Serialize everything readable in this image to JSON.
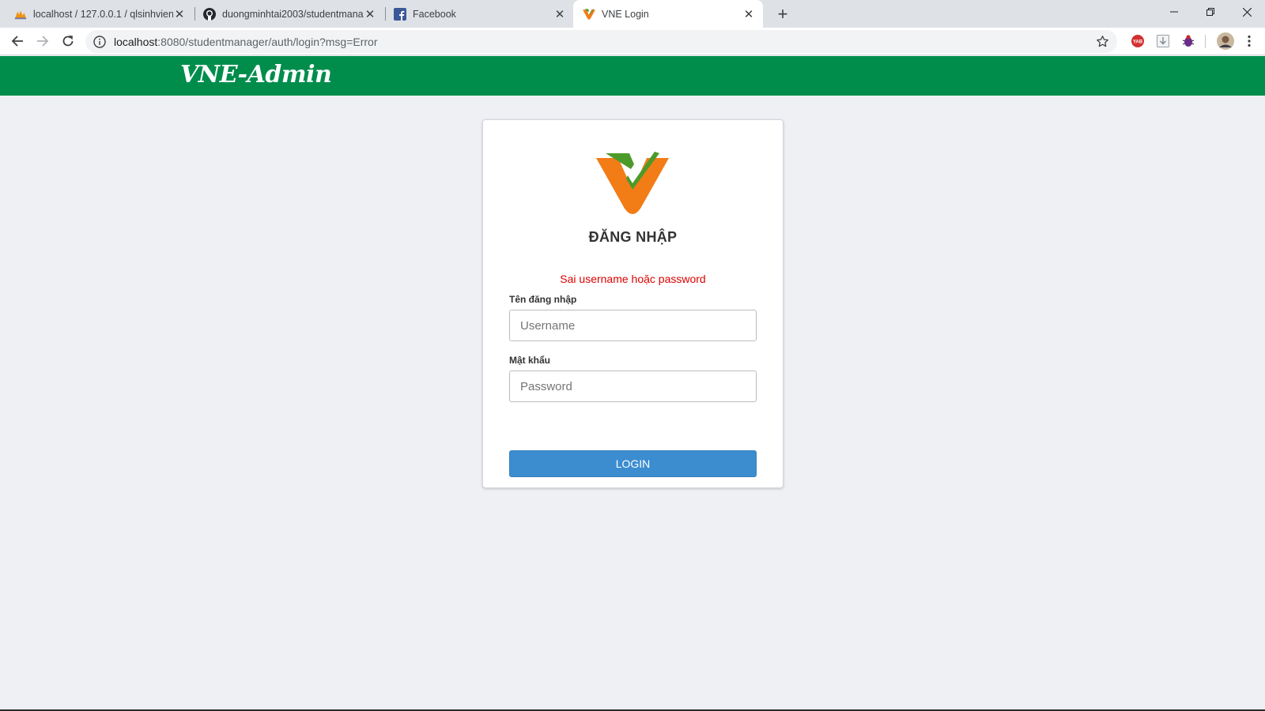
{
  "browser": {
    "tabs": [
      {
        "title": "localhost / 127.0.0.1 / qlsinhvien",
        "icon": "phpmyadmin-icon"
      },
      {
        "title": "duongminhtai2003/studentmana",
        "icon": "github-icon"
      },
      {
        "title": "Facebook",
        "icon": "facebook-icon"
      },
      {
        "title": "VNE Login",
        "icon": "vne-icon",
        "active": true
      }
    ],
    "close_glyph": "✕",
    "newtab_glyph": "+",
    "url_host": "localhost",
    "url_path": ":8080/studentmanager/auth/login?msg=Error",
    "extensions": [
      "yab-extension-icon",
      "download-extension-icon",
      "bug-extension-icon",
      "profile-avatar"
    ],
    "window_controls": {
      "minimize": "—",
      "restore": "❐",
      "close": "✕"
    }
  },
  "header": {
    "brand": "VNE-Admin",
    "color": "#008d4c"
  },
  "login": {
    "title": "ĐĂNG NHẬP",
    "error": "Sai username hoặc password",
    "username_label": "Tên đăng nhập",
    "username_placeholder": "Username",
    "username_value": "",
    "password_label": "Mật khẩu",
    "password_placeholder": "Password",
    "password_value": "",
    "button": "LOGIN",
    "button_color": "#3c8dd0",
    "error_color": "#dd0000"
  }
}
